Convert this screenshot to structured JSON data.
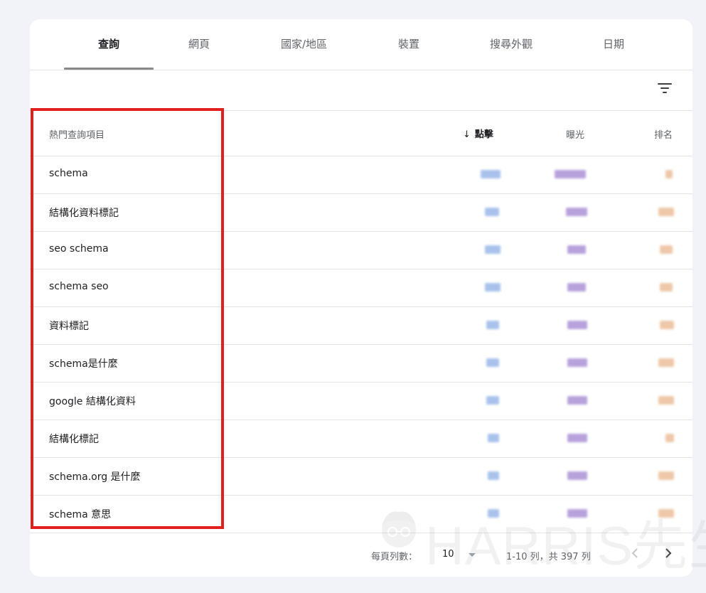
{
  "tabs": [
    {
      "label": "查詢"
    },
    {
      "label": "網頁"
    },
    {
      "label": "國家/地區"
    },
    {
      "label": "裝置"
    },
    {
      "label": "搜尋外觀"
    },
    {
      "label": "日期"
    }
  ],
  "active_tab": "查詢",
  "table": {
    "headers": {
      "query": "熱門查詢項目",
      "clicks": "點擊",
      "impressions": "曝光",
      "position": "排名"
    },
    "sort_column": "clicks",
    "sort_direction": "descending",
    "rows": [
      {
        "query": "schema"
      },
      {
        "query": "結構化資料標記"
      },
      {
        "query": "seo schema"
      },
      {
        "query": "schema seo"
      },
      {
        "query": "資料標記"
      },
      {
        "query": "schema是什麼"
      },
      {
        "query": "google 結構化資料"
      },
      {
        "query": "結構化標記"
      },
      {
        "query": "schema.org 是什麼"
      },
      {
        "query": "schema 意思"
      }
    ]
  },
  "pagination": {
    "rows_per_page_label": "每頁列數：",
    "rows_per_page": "10",
    "range": "1-10 列，共 397 列"
  },
  "watermark": {
    "text": "HARRIS先生"
  },
  "icons": {
    "filter": "filter-icon",
    "sort": "arrow-down-icon",
    "prev": "chevron-left-icon",
    "next": "chevron-right-icon",
    "watermark_logo": "face-logo-icon"
  },
  "colors": {
    "highlight_border": "#e0201f",
    "clicks_blur": "#a9c2ec",
    "impressions_blur": "#b8a2dc",
    "position_blur": "#eec8a8"
  }
}
